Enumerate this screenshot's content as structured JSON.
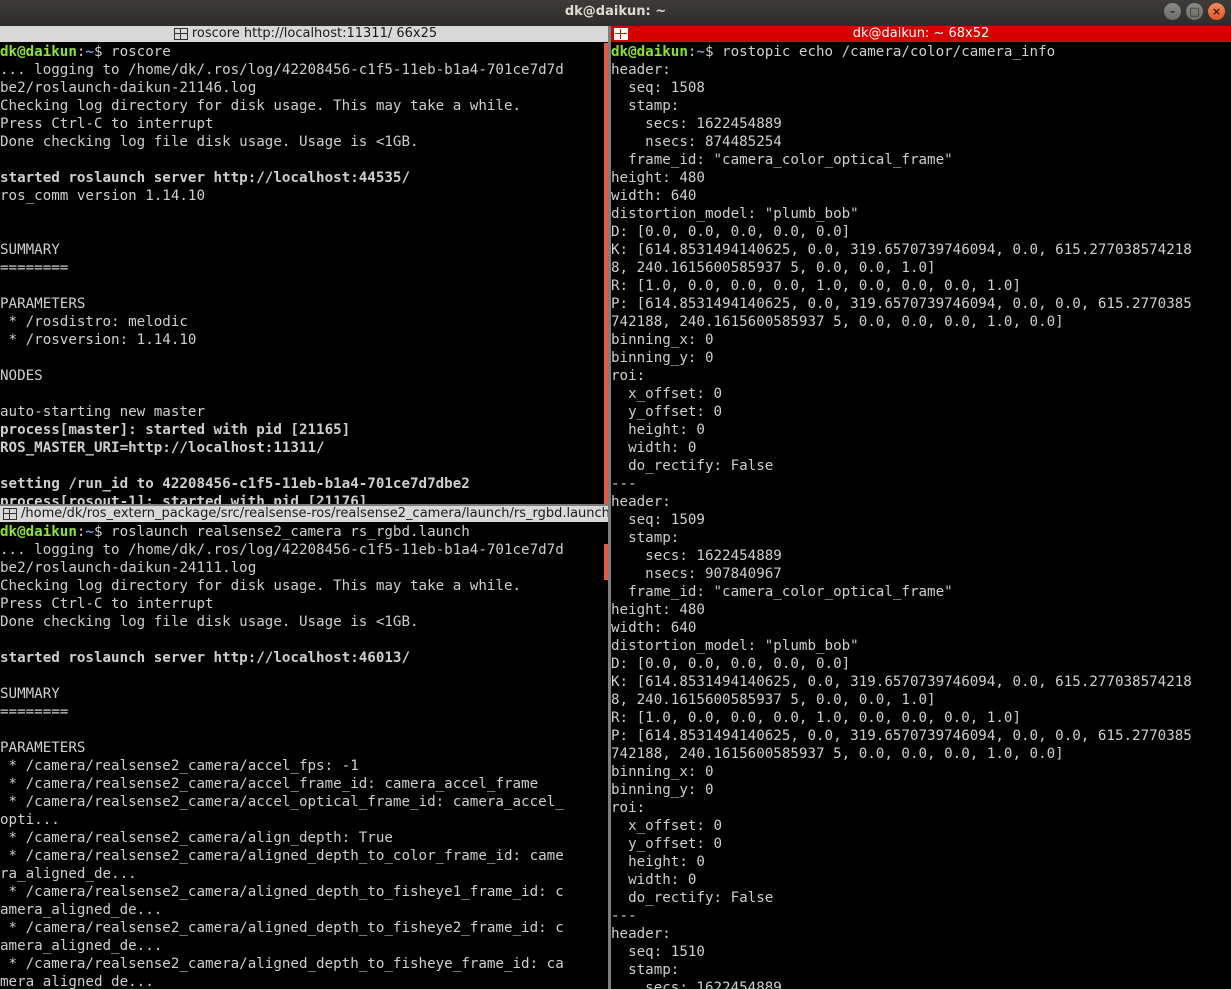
{
  "window": {
    "title": "dk@daikun: ~"
  },
  "panes": [
    {
      "title": "roscore http://localhost:11311/ 66x25",
      "lines": [
        {
          "p": "dk@daikun",
          "path": "~",
          "cmd": "$ roscore"
        },
        {
          "t": "... logging to /home/dk/.ros/log/42208456-c1f5-11eb-b1a4-701ce7d7d"
        },
        {
          "t": "be2/roslaunch-daikun-21146.log"
        },
        {
          "t": "Checking log directory for disk usage. This may take a while."
        },
        {
          "t": "Press Ctrl-C to interrupt"
        },
        {
          "t": "Done checking log file disk usage. Usage is <1GB."
        },
        {
          "t": ""
        },
        {
          "t": "started roslaunch server http://localhost:44535/",
          "b": true
        },
        {
          "t": "ros_comm version 1.14.10"
        },
        {
          "t": ""
        },
        {
          "t": ""
        },
        {
          "t": "SUMMARY"
        },
        {
          "t": "========"
        },
        {
          "t": ""
        },
        {
          "t": "PARAMETERS"
        },
        {
          "t": " * /rosdistro: melodic"
        },
        {
          "t": " * /rosversion: 1.14.10"
        },
        {
          "t": ""
        },
        {
          "t": "NODES"
        },
        {
          "t": ""
        },
        {
          "t": "auto-starting new master"
        },
        {
          "t": "process[master]: started with pid [21165]",
          "b": true
        },
        {
          "t": "ROS_MASTER_URI=http://localhost:11311/",
          "b": true
        },
        {
          "t": ""
        },
        {
          "t": "setting /run_id to 42208456-c1f5-11eb-b1a4-701ce7d7dbe2",
          "b": true
        },
        {
          "t": "process[rosout-1]: started with pid [21176]",
          "b": true
        }
      ]
    },
    {
      "title": "/home/dk/ros_extern_package/src/realsense-ros/realsense2_camera/launch/rs_rgbd.launch",
      "lines": [
        {
          "p": "dk@daikun",
          "path": "~",
          "cmd": "$ roslaunch realsense2_camera rs_rgbd.launch"
        },
        {
          "t": "... logging to /home/dk/.ros/log/42208456-c1f5-11eb-b1a4-701ce7d7d"
        },
        {
          "t": "be2/roslaunch-daikun-24111.log"
        },
        {
          "t": "Checking log directory for disk usage. This may take a while."
        },
        {
          "t": "Press Ctrl-C to interrupt"
        },
        {
          "t": "Done checking log file disk usage. Usage is <1GB."
        },
        {
          "t": ""
        },
        {
          "t": "started roslaunch server http://localhost:46013/",
          "b": true
        },
        {
          "t": ""
        },
        {
          "t": "SUMMARY"
        },
        {
          "t": "========"
        },
        {
          "t": ""
        },
        {
          "t": "PARAMETERS"
        },
        {
          "t": " * /camera/realsense2_camera/accel_fps: -1"
        },
        {
          "t": " * /camera/realsense2_camera/accel_frame_id: camera_accel_frame"
        },
        {
          "t": " * /camera/realsense2_camera/accel_optical_frame_id: camera_accel_"
        },
        {
          "t": "opti..."
        },
        {
          "t": " * /camera/realsense2_camera/align_depth: True"
        },
        {
          "t": " * /camera/realsense2_camera/aligned_depth_to_color_frame_id: came"
        },
        {
          "t": "ra_aligned_de..."
        },
        {
          "t": " * /camera/realsense2_camera/aligned_depth_to_fisheye1_frame_id: c"
        },
        {
          "t": "amera_aligned_de..."
        },
        {
          "t": " * /camera/realsense2_camera/aligned_depth_to_fisheye2_frame_id: c"
        },
        {
          "t": "amera_aligned_de..."
        },
        {
          "t": " * /camera/realsense2_camera/aligned_depth_to_fisheye_frame_id: ca"
        },
        {
          "t": "mera_aligned_de..."
        }
      ]
    },
    {
      "title": "dk@daikun: ~ 68x52",
      "lines": [
        {
          "p": "dk@daikun",
          "path": "~",
          "cmd": "$ rostopic echo /camera/color/camera_info"
        },
        {
          "t": "header:"
        },
        {
          "t": "  seq: 1508"
        },
        {
          "t": "  stamp:"
        },
        {
          "t": "    secs: 1622454889"
        },
        {
          "t": "    nsecs: 874485254"
        },
        {
          "t": "  frame_id: \"camera_color_optical_frame\""
        },
        {
          "t": "height: 480"
        },
        {
          "t": "width: 640"
        },
        {
          "t": "distortion_model: \"plumb_bob\""
        },
        {
          "t": "D: [0.0, 0.0, 0.0, 0.0, 0.0]"
        },
        {
          "t": "K: [614.8531494140625, 0.0, 319.6570739746094, 0.0, 615.277038574218"
        },
        {
          "t": "8, 240.1615600585937 5, 0.0, 0.0, 1.0]"
        },
        {
          "t": "R: [1.0, 0.0, 0.0, 0.0, 1.0, 0.0, 0.0, 0.0, 1.0]"
        },
        {
          "t": "P: [614.8531494140625, 0.0, 319.6570739746094, 0.0, 0.0, 615.2770385"
        },
        {
          "t": "742188, 240.1615600585937 5, 0.0, 0.0, 0.0, 1.0, 0.0]"
        },
        {
          "t": "binning_x: 0"
        },
        {
          "t": "binning_y: 0"
        },
        {
          "t": "roi:"
        },
        {
          "t": "  x_offset: 0"
        },
        {
          "t": "  y_offset: 0"
        },
        {
          "t": "  height: 0"
        },
        {
          "t": "  width: 0"
        },
        {
          "t": "  do_rectify: False"
        },
        {
          "t": "---"
        },
        {
          "t": "header:"
        },
        {
          "t": "  seq: 1509"
        },
        {
          "t": "  stamp:"
        },
        {
          "t": "    secs: 1622454889"
        },
        {
          "t": "    nsecs: 907840967"
        },
        {
          "t": "  frame_id: \"camera_color_optical_frame\""
        },
        {
          "t": "height: 480"
        },
        {
          "t": "width: 640"
        },
        {
          "t": "distortion_model: \"plumb_bob\""
        },
        {
          "t": "D: [0.0, 0.0, 0.0, 0.0, 0.0]"
        },
        {
          "t": "K: [614.8531494140625, 0.0, 319.6570739746094, 0.0, 615.277038574218"
        },
        {
          "t": "8, 240.1615600585937 5, 0.0, 0.0, 1.0]"
        },
        {
          "t": "R: [1.0, 0.0, 0.0, 0.0, 1.0, 0.0, 0.0, 0.0, 1.0]"
        },
        {
          "t": "P: [614.8531494140625, 0.0, 319.6570739746094, 0.0, 0.0, 615.2770385"
        },
        {
          "t": "742188, 240.1615600585937 5, 0.0, 0.0, 0.0, 1.0, 0.0]"
        },
        {
          "t": "binning_x: 0"
        },
        {
          "t": "binning_y: 0"
        },
        {
          "t": "roi:"
        },
        {
          "t": "  x_offset: 0"
        },
        {
          "t": "  y_offset: 0"
        },
        {
          "t": "  height: 0"
        },
        {
          "t": "  width: 0"
        },
        {
          "t": "  do_rectify: False"
        },
        {
          "t": "---"
        },
        {
          "t": "header:"
        },
        {
          "t": "  seq: 1510"
        },
        {
          "t": "  stamp:"
        },
        {
          "t": "    secs: 1622454889"
        }
      ]
    }
  ],
  "colors": {
    "active_title_bg": "#d70000",
    "prompt_user": "#8ae234",
    "prompt_path": "#729fcf",
    "scrollbar": "#e05b3a"
  }
}
